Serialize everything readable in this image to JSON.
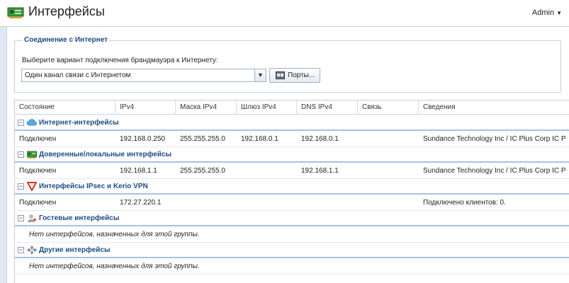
{
  "header": {
    "title": "Интерфейсы",
    "user": "Admin"
  },
  "connection": {
    "legend": "Соединение с Интернет",
    "prompt": "Выберите вариант подключения брандмауэра к Интернету:",
    "selected": "Один канал связи с Интернетом",
    "ports_label": "Порты..."
  },
  "grid": {
    "columns": [
      "Состояние",
      "IPv4",
      "Маска IPv4",
      "Шлюз IPv4",
      "DNS IPv4",
      "Связь",
      "Сведения"
    ],
    "groups": [
      {
        "label": "Интернет-интерфейсы",
        "icon": "cloud-icon",
        "rows": [
          {
            "status": "Подключен",
            "ipv4": "192.168.0.250",
            "mask": "255.255.255.0",
            "gateway": "192.168.0.1",
            "dns": "192.168.0.1",
            "link": "",
            "info": "Sundance Technology Inc / IC Plus Corp IC P"
          }
        ]
      },
      {
        "label": "Доверенные/локальные интерфейсы",
        "icon": "network-card-icon",
        "rows": [
          {
            "status": "Подключен",
            "ipv4": "192.168.1.1",
            "mask": "255.255.255.0",
            "gateway": "",
            "dns": "192.168.1.1",
            "link": "",
            "info": "Sundance Technology Inc / IC Plus Corp IC P"
          }
        ]
      },
      {
        "label": "Интерфейсы IPsec и Kerio VPN",
        "icon": "vpn-shield-icon",
        "rows": [
          {
            "status": "Подключен",
            "ipv4": "172.27.220.1",
            "mask": "",
            "gateway": "",
            "dns": "",
            "link": "",
            "info": "Подключено клиентов: 0."
          }
        ]
      },
      {
        "label": "Гостевые интерфейсы",
        "icon": "guest-user-icon",
        "empty": "Нет интерфейсов, назначенных для этой группы."
      },
      {
        "label": "Другие интерфейсы",
        "icon": "other-interfaces-icon",
        "empty": "Нет интерфейсов, назначенных для этой группы."
      }
    ]
  },
  "colors": {
    "group_label": "#1e4b85",
    "group_separator": "#a7c2e2",
    "background": "#dfe8f3"
  }
}
